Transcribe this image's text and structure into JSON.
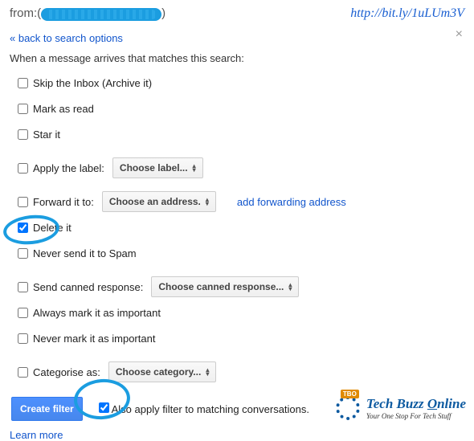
{
  "header": {
    "from_label": "from:(",
    "from_close": ")",
    "url": "http://bit.ly/1uLUm3V"
  },
  "back_link": "« back to search options",
  "intro": "When a message arrives that matches this search:",
  "options": {
    "skip_inbox": "Skip the Inbox (Archive it)",
    "mark_read": "Mark as read",
    "star_it": "Star it",
    "apply_label": "Apply the label:",
    "label_dropdown": "Choose label...",
    "forward_to": "Forward it to:",
    "address_dropdown": "Choose an address.",
    "add_forwarding": "add forwarding address",
    "delete_it": "Delete it",
    "never_spam": "Never send it to Spam",
    "canned": "Send canned response:",
    "canned_dropdown": "Choose canned response...",
    "always_important": "Always mark it as important",
    "never_important": "Never mark it as important",
    "categorise": "Categorise as:",
    "category_dropdown": "Choose category..."
  },
  "footer": {
    "create_button": "Create filter",
    "also_apply": "Also apply filter to matching conversations.",
    "learn_more": "Learn more"
  },
  "brand": {
    "badge": "TBO",
    "title_pre": "Tech Buzz ",
    "title_u": "O",
    "title_post": "nline",
    "subtitle": "Your One Stop For Tech Stuff"
  }
}
